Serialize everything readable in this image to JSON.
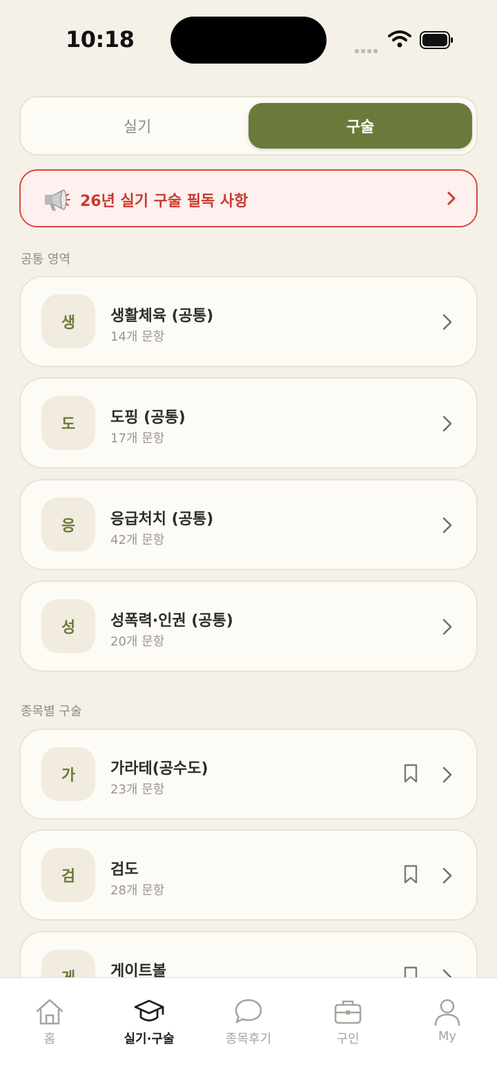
{
  "status": {
    "time": "10:18"
  },
  "segment": {
    "left_label": "실기",
    "right_label": "구술"
  },
  "notice": {
    "text": "26년 실기 구술 필독 사항"
  },
  "sections": {
    "common_title": "공통 영역",
    "sport_title": "종목별 구술"
  },
  "common_items": [
    {
      "badge": "생",
      "title": "생활체육 (공통)",
      "count": "14개 문항"
    },
    {
      "badge": "도",
      "title": "도핑 (공통)",
      "count": "17개 문항"
    },
    {
      "badge": "응",
      "title": "응급처치 (공통)",
      "count": "42개 문항"
    },
    {
      "badge": "성",
      "title": "성폭력·인권 (공통)",
      "count": "20개 문항"
    }
  ],
  "sport_items": [
    {
      "badge": "가",
      "title": "가라테(공수도)",
      "count": "23개 문항"
    },
    {
      "badge": "검",
      "title": "검도",
      "count": "28개 문항"
    },
    {
      "badge": "게",
      "title": "게이트볼",
      "count": ""
    }
  ],
  "tabs": [
    {
      "label": "홈",
      "icon": "home-icon"
    },
    {
      "label": "실기·구술",
      "icon": "graduation-cap-icon"
    },
    {
      "label": "종목후기",
      "icon": "chat-bubble-icon"
    },
    {
      "label": "구인",
      "icon": "briefcase-icon"
    },
    {
      "label": "My",
      "icon": "person-icon"
    }
  ],
  "colors": {
    "accent": "#6B7A3A",
    "background": "#F5F1E8",
    "notice_red": "#C93A2E"
  }
}
